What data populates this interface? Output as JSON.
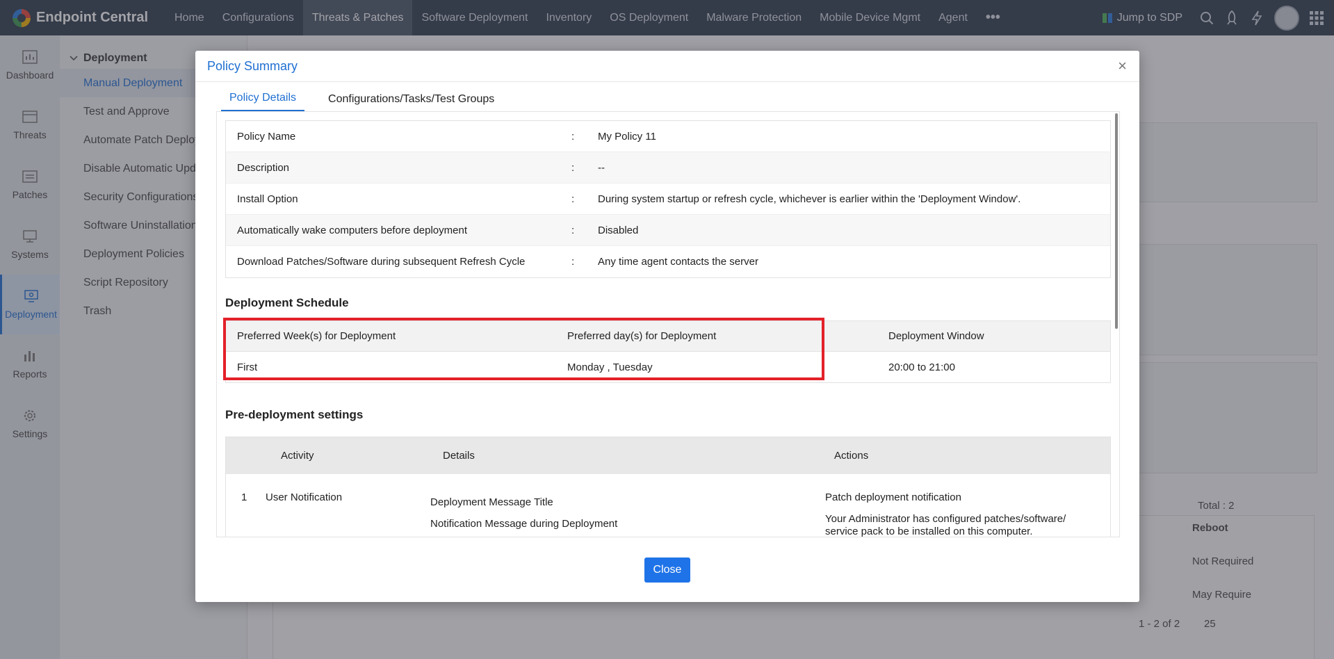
{
  "app": {
    "name": "Endpoint Central"
  },
  "nav": [
    "Home",
    "Configurations",
    "Threats & Patches",
    "Software Deployment",
    "Inventory",
    "OS Deployment",
    "Malware Protection",
    "Mobile Device Mgmt",
    "Agent"
  ],
  "topright": {
    "jump": "Jump to SDP"
  },
  "sidebar": [
    "Dashboard",
    "Threats",
    "Patches",
    "Systems",
    "Deployment",
    "Reports",
    "Settings"
  ],
  "subpanel": {
    "header": "Deployment",
    "items": [
      "Manual Deployment",
      "Test and Approve",
      "Automate Patch Deployment",
      "Disable Automatic Updates",
      "Security Configurations",
      "Software Uninstallation",
      "Deployment Policies",
      "Script Repository",
      "Trash"
    ]
  },
  "background": {
    "total": "Total : 2",
    "reboot_header": "Reboot",
    "reboot_1": "Not Required",
    "reboot_2": "May Require",
    "paging": "1 - 2 of 2",
    "page_size": "25"
  },
  "modal": {
    "title": "Policy Summary",
    "tabs": [
      "Policy Details",
      "Configurations/Tasks/Test Groups"
    ],
    "details": [
      {
        "key": "Policy Name",
        "value": "My Policy 11"
      },
      {
        "key": "Description",
        "value": "--"
      },
      {
        "key": "Install Option",
        "value": "During system startup or refresh cycle, whichever is earlier within the 'Deployment Window'."
      },
      {
        "key": "Automatically wake computers before deployment",
        "value": "Disabled"
      },
      {
        "key": "Download Patches/Software during subsequent Refresh Cycle",
        "value": "Any time agent contacts the server"
      }
    ],
    "separator": ":",
    "schedule": {
      "title": "Deployment Schedule",
      "headers": [
        "Preferred Week(s) for Deployment",
        "Preferred day(s) for Deployment",
        "Deployment Window"
      ],
      "row": [
        "First",
        "Monday , Tuesday",
        "20:00 to 21:00"
      ]
    },
    "pre": {
      "title": "Pre-deployment settings",
      "headers": [
        "Activity",
        "Details",
        "Actions"
      ],
      "row": {
        "num": "1",
        "activity": "User Notification",
        "details": [
          "Deployment Message Title",
          "Notification Message during Deployment"
        ],
        "actions": [
          "Patch deployment notification",
          "Your Administrator has configured patches/software/ service pack to be installed on this computer."
        ]
      }
    },
    "close_label": "Close"
  }
}
